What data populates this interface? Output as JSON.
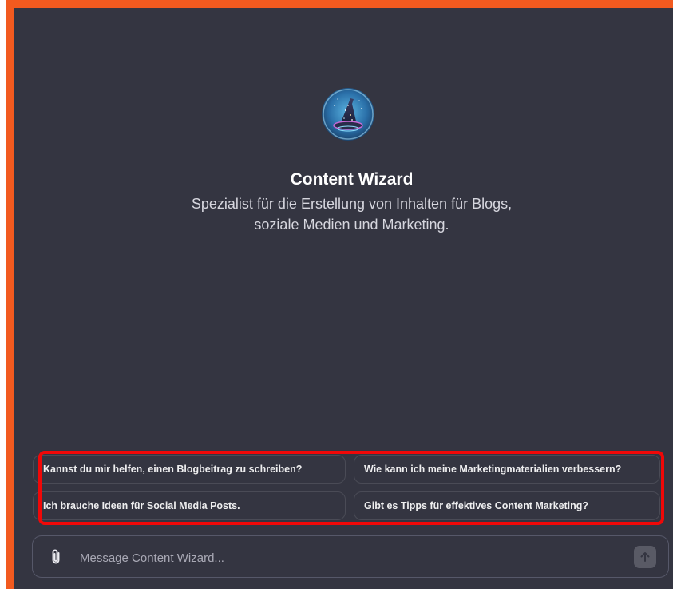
{
  "gpt": {
    "name": "Content Wizard",
    "description_line1": "Spezialist für die Erstellung von Inhalten für Blogs,",
    "description_line2": "soziale Medien und Marketing.",
    "avatar_icon": "wizard-hat-icon"
  },
  "suggestions": [
    {
      "label": "Kannst du mir helfen, einen Blogbeitrag zu schreiben?"
    },
    {
      "label": "Wie kann ich meine Marketingmaterialien verbessern?"
    },
    {
      "label": "Ich brauche Ideen für Social Media Posts."
    },
    {
      "label": "Gibt es Tipps für effektives Content Marketing?"
    }
  ],
  "composer": {
    "placeholder": "Message Content Wizard...",
    "attach_icon": "paperclip-icon",
    "send_icon": "arrow-up-icon"
  },
  "colors": {
    "background": "#343541",
    "highlight_border": "#f00808",
    "frame_accent": "#f25a1f"
  }
}
